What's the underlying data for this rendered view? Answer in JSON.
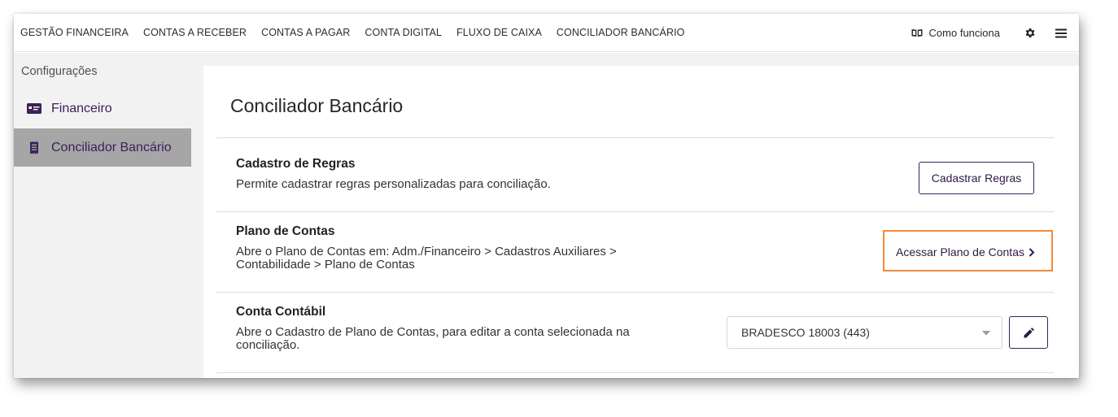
{
  "topnav": {
    "items": [
      {
        "label": "GESTÃO FINANCEIRA"
      },
      {
        "label": "CONTAS A RECEBER"
      },
      {
        "label": "CONTAS A PAGAR"
      },
      {
        "label": "CONTA DIGITAL"
      },
      {
        "label": "FLUXO DE CAIXA"
      },
      {
        "label": "CONCILIADOR BANCÁRIO"
      }
    ],
    "how_it_works": "Como funciona",
    "how_icon": "book-open-icon",
    "settings_icon": "gear-icon",
    "menu_icon": "hamburger-menu-icon"
  },
  "sidebar": {
    "title": "Configurações",
    "items": [
      {
        "label": "Financeiro",
        "icon": "credit-card-icon"
      },
      {
        "label": "Conciliador Bancário",
        "icon": "receipt-icon",
        "active": true
      }
    ]
  },
  "main": {
    "title": "Conciliador Bancário",
    "sections": [
      {
        "title": "Cadastro de Regras",
        "description": "Permite cadastrar regras personalizadas para conciliação.",
        "button": "Cadastrar Regras"
      },
      {
        "title": "Plano de Contas",
        "description_line1": "Abre o Plano de Contas em: Adm./Financeiro > Cadastros Auxiliares >",
        "description_line2": "Contabilidade > Plano de Contas",
        "link": "Acessar Plano de Contas"
      },
      {
        "title": "Conta Contábil",
        "description_line1": "Abre o Cadastro de Plano de Contas, para editar a conta selecionada na",
        "description_line2": "conciliação.",
        "select_value": "BRADESCO 18003 (443)",
        "edit_icon": "pencil-icon"
      }
    ]
  },
  "colors": {
    "brand": "#3b2357",
    "highlight": "#f08a3c",
    "active_sidebar": "#a6a6a6",
    "background": "#f2f2f2"
  }
}
